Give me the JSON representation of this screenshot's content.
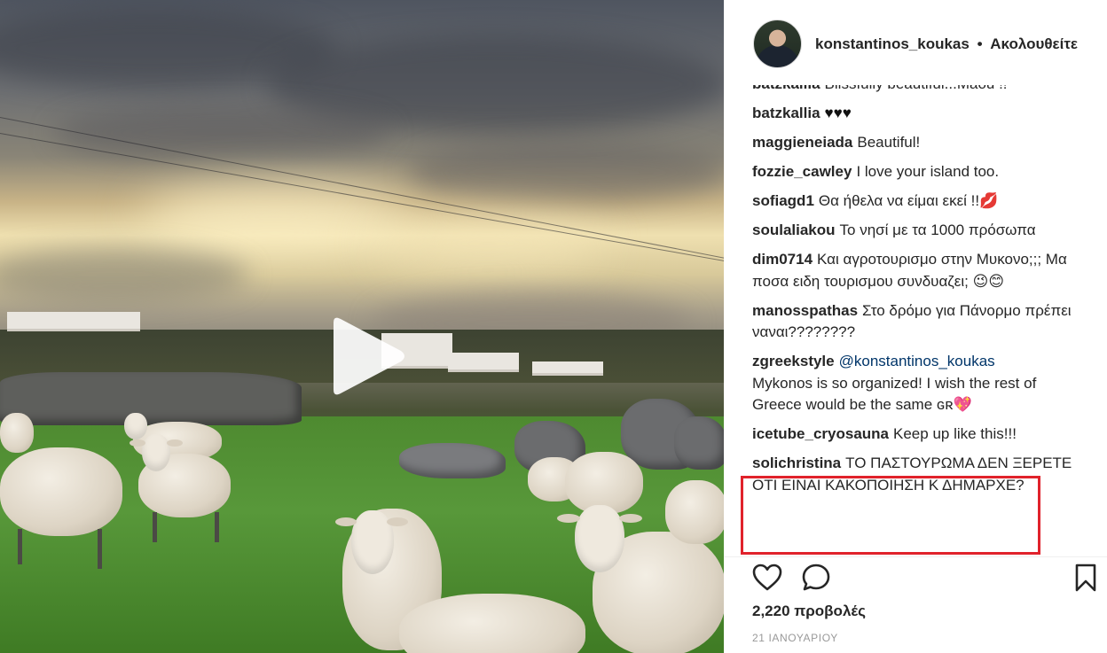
{
  "post": {
    "author": "konstantinos_koukas",
    "separator": "•",
    "follow_label": "Ακολουθείτε"
  },
  "comments": [
    {
      "user": "batzkallia",
      "text": "Blissfully beautiful...Maou !!"
    },
    {
      "user": "batzkallia",
      "text": "♥♥♥"
    },
    {
      "user": "maggieneiada",
      "text": "Beautiful!"
    },
    {
      "user": "fozzie_cawley",
      "text": "I love your island too."
    },
    {
      "user": "sofiagd1",
      "text": "Θα ήθελα να είμαι εκεί !!💋"
    },
    {
      "user": "soulaliakou",
      "text": "Το νησί με τα 1000 πρόσωπα"
    },
    {
      "user": "dim0714",
      "text": "Και αγροτουρισμο στην Μυκονο;;; Μα ποσα ειδη τουρισμου συνδυαζει; 😉😊"
    },
    {
      "user": "manosspathas",
      "text": "Στο δρόμο για Πάνορμο πρέπει ναναι????????"
    },
    {
      "user": "zgreekstyle",
      "mention": "@konstantinos_koukas",
      "text": "Mykonos is so organized! I wish the rest of Greece would be the same ɢʀ💖"
    },
    {
      "user": "icetube_cryosauna",
      "text": "Keep up like this!!!"
    },
    {
      "user": "solichristina",
      "text": "ΤΟ ΠΑΣΤΟΥΡΩΜΑ ΔΕΝ ΞΕΡΕΤΕ ΟΤΙ ΕΙΝΑΙ ΚΑΚΟΠΟΙΗΣΗ Κ ΔΗΜΑΡΧΕ?"
    }
  ],
  "stats": {
    "views": "2,220 προβολές",
    "date": "21 ΙΑΝΟΥΑΡΙΟΥ"
  },
  "icons": {
    "like": "heart-icon",
    "comment": "comment-bubble-icon",
    "save": "bookmark-icon",
    "play": "play-icon"
  },
  "colors": {
    "highlight": "#e0222b",
    "mention": "#003569",
    "date": "#999999"
  }
}
